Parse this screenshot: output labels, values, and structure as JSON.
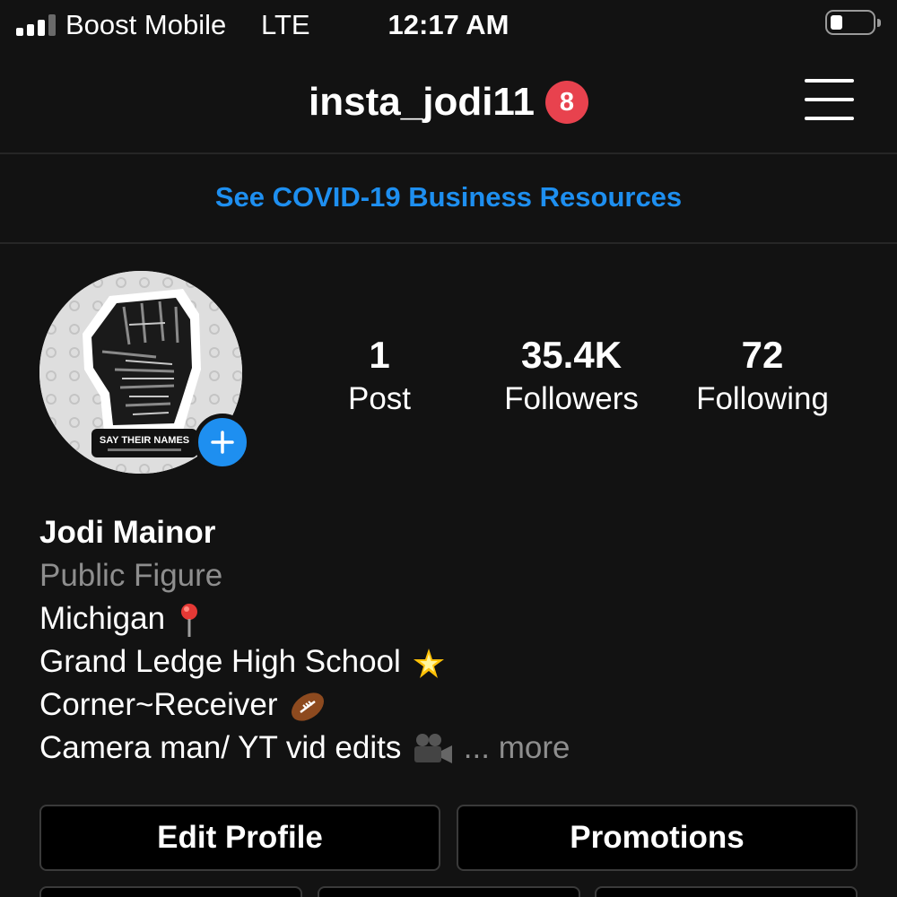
{
  "status_bar": {
    "carrier": "Boost Mobile",
    "network": "LTE",
    "time": "12:17 AM",
    "signal_bars": 3,
    "battery_level": 0.2
  },
  "header": {
    "username": "insta_jodi11",
    "notification_count": "8",
    "menu_icon": "hamburger-menu-icon"
  },
  "banner": {
    "link_text": "See COVID-19 Business Resources",
    "color": "#1e8ff0"
  },
  "profile": {
    "avatar_icon": "raised-fist-sticker-icon",
    "avatar_text": "SAY THEIR NAMES",
    "add_story_icon": "plus-icon",
    "stats": {
      "posts": {
        "value": "1",
        "label": "Post"
      },
      "followers": {
        "value": "35.4K",
        "label": "Followers"
      },
      "following": {
        "value": "72",
        "label": "Following"
      }
    }
  },
  "bio": {
    "name": "Jodi Mainor",
    "category": "Public Figure",
    "line1": "Michigan",
    "line2": "Grand Ledge High School",
    "line3": "Corner~Receiver",
    "line4": "Camera man/ YT vid edits",
    "ellipsis": "...",
    "more": "more",
    "icons": [
      "pin-icon",
      "star-icon",
      "football-icon",
      "video-camera-icon"
    ]
  },
  "buttons": {
    "edit_profile": "Edit Profile",
    "promotions": "Promotions"
  },
  "colors": {
    "background": "#121212",
    "badge": "#e8424e",
    "accent": "#1e8ff0",
    "secondary_text": "#8e8e8e"
  }
}
